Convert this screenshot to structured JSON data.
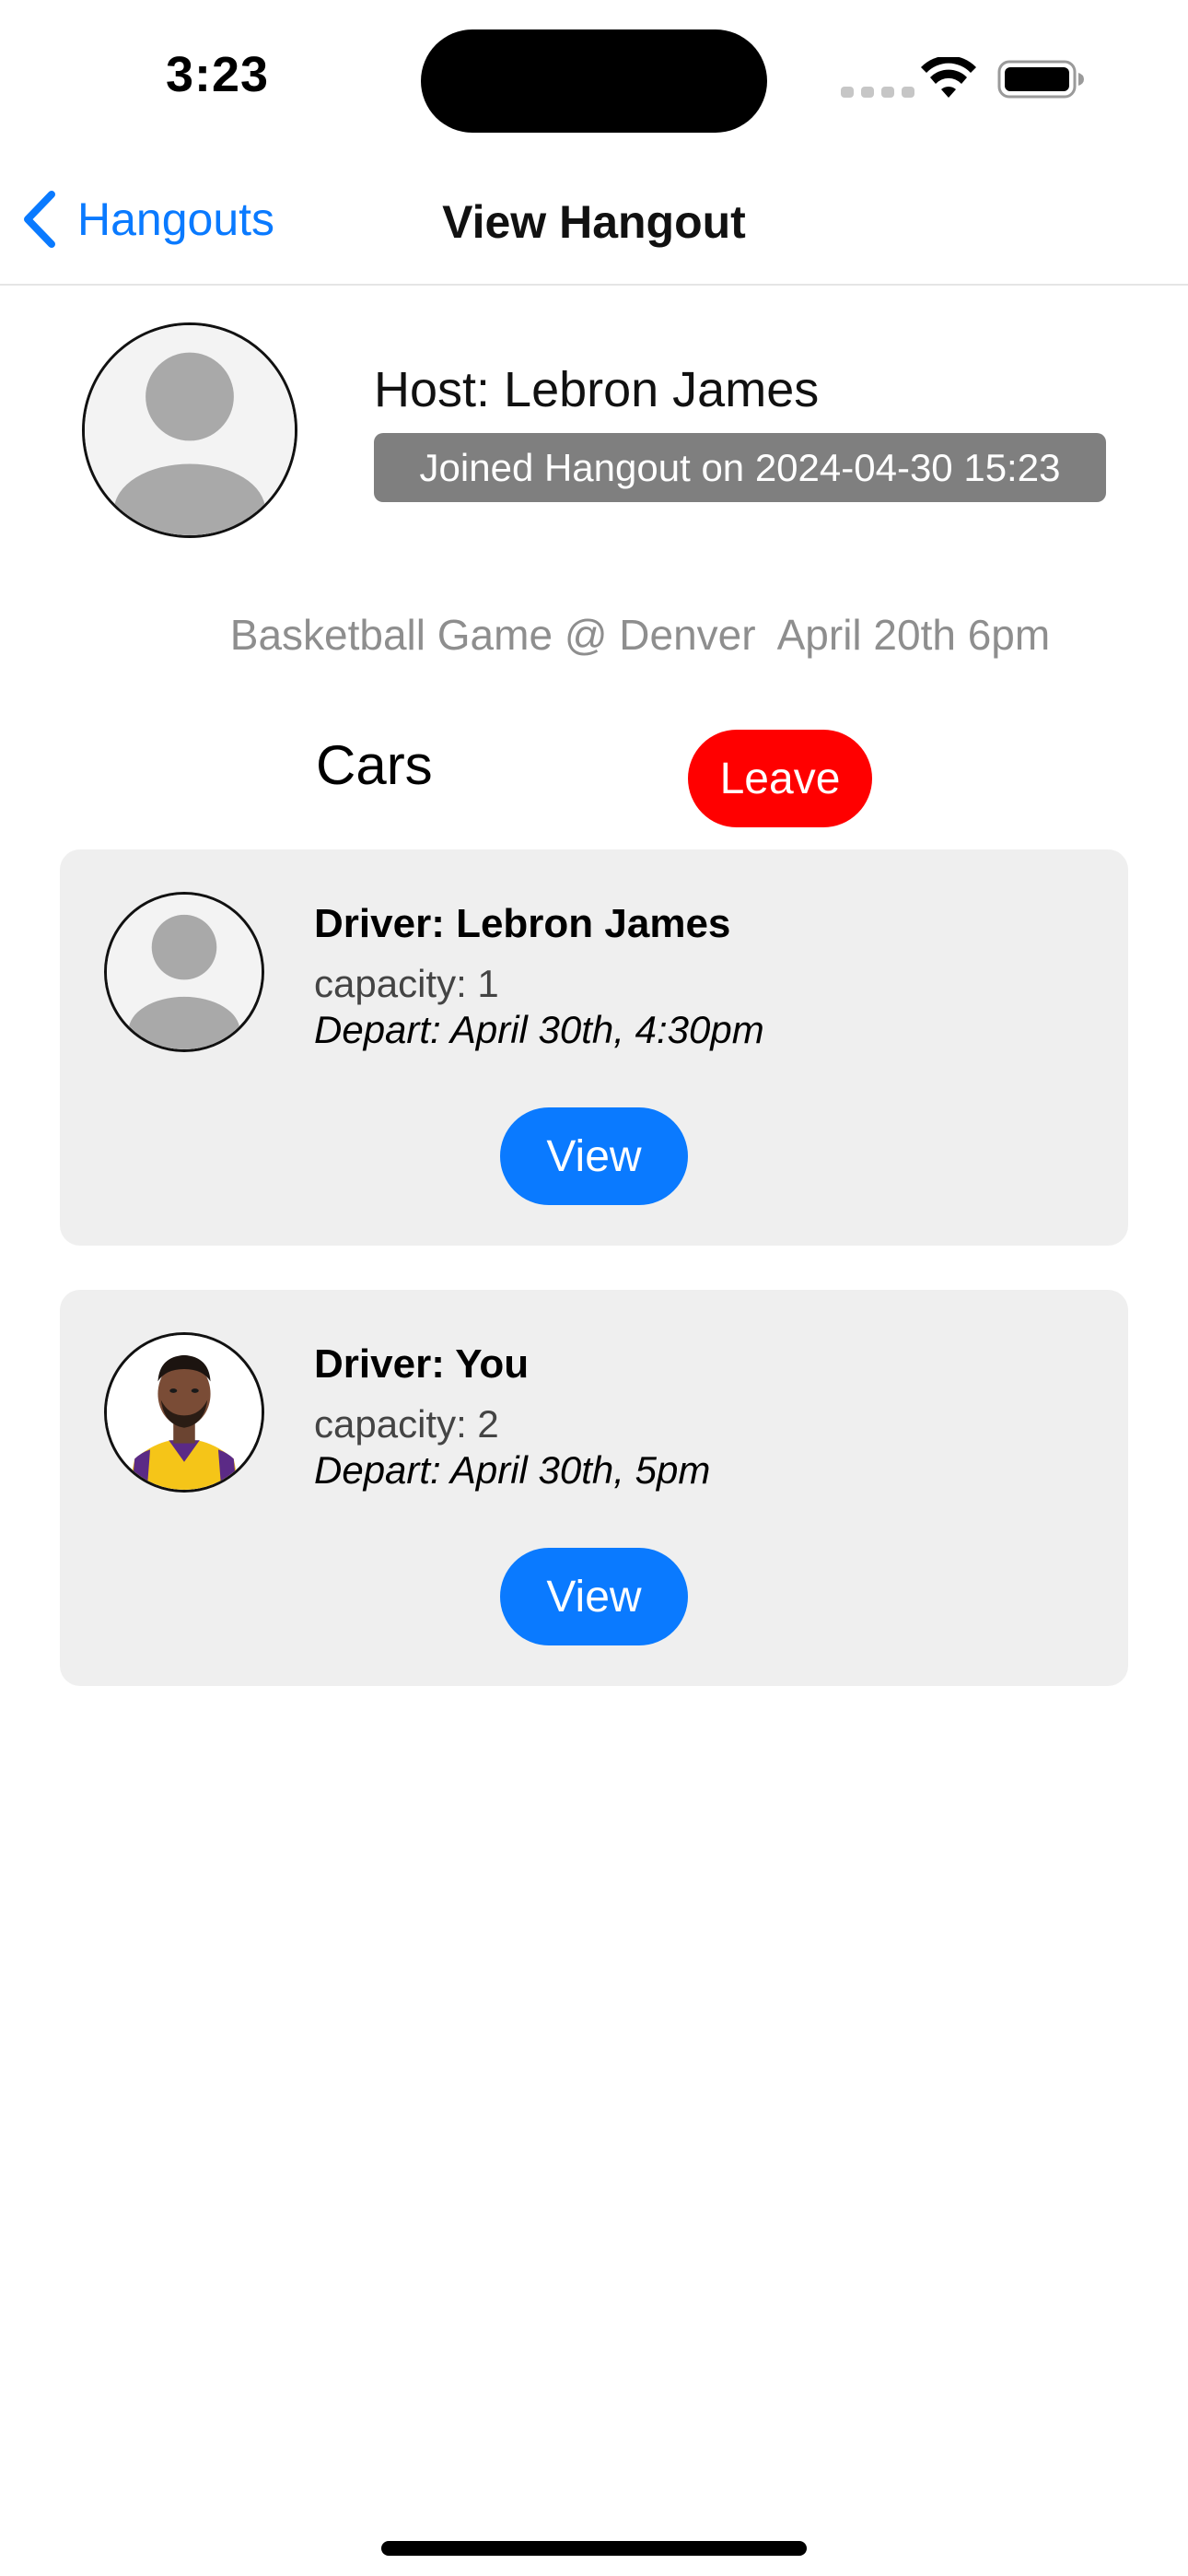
{
  "status_bar": {
    "time": "3:23",
    "icons": [
      "signal-dots-icon",
      "wifi-icon",
      "battery-icon"
    ]
  },
  "nav": {
    "back_label": "Hangouts",
    "title": "View Hangout"
  },
  "host": {
    "name": "Host: Lebron James",
    "joined": "Joined Hangout on 2024-04-30 15:23"
  },
  "event": {
    "description": "Basketball Game @ Denver  April 20th 6pm"
  },
  "cars": {
    "heading": "Cars",
    "leave_label": "Leave",
    "items": [
      {
        "driver": "Driver: Lebron James",
        "capacity": "capacity: 1",
        "depart": "Depart: April 30th, 4:30pm",
        "view_label": "View",
        "avatar": "placeholder-avatar"
      },
      {
        "driver": "Driver: You",
        "capacity": "capacity: 2",
        "depart": "Depart: April 30th, 5pm",
        "view_label": "View",
        "avatar": "player-photo"
      }
    ]
  },
  "colors": {
    "accent": "#0a7aff",
    "danger": "#ff0000",
    "card_bg": "#efefef",
    "badge_bg": "#7f7f7f",
    "muted_text": "#8e8e8e"
  }
}
